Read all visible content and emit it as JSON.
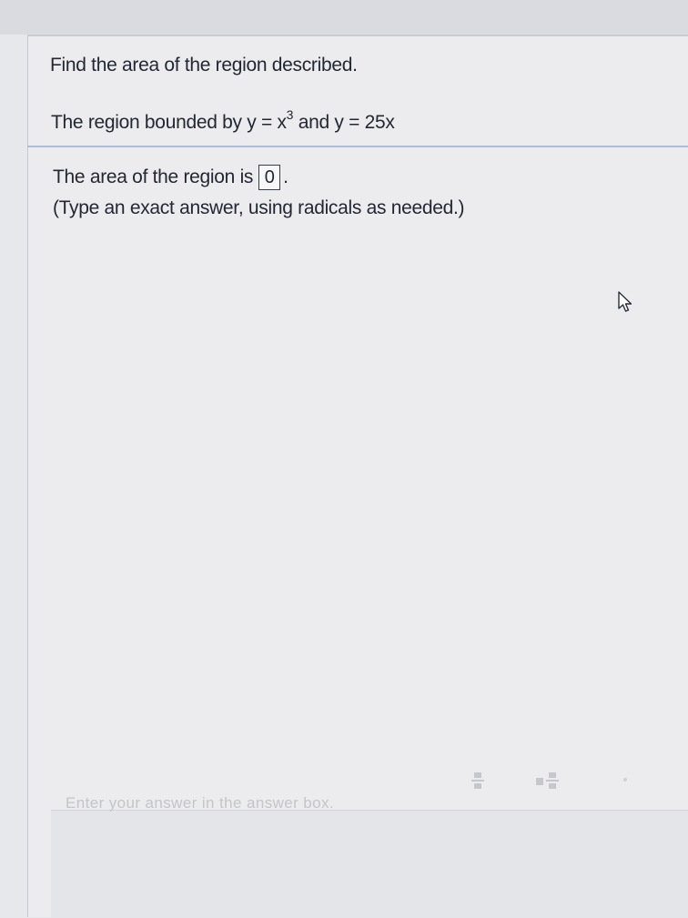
{
  "question": {
    "title": "Find the area of the region described.",
    "region_prefix": "The region bounded by y = x",
    "region_exponent": "3",
    "region_suffix": " and y = 25x"
  },
  "answer": {
    "prompt": "The area of the region is",
    "value": "0",
    "period": ".",
    "hint": "(Type an exact answer, using radicals as needed.)"
  },
  "footer": {
    "status": "Enter your answer in the answer box."
  },
  "icons": {
    "cursor": "mouse-pointer-icon",
    "toolbar": [
      "fraction-icon",
      "mixed-number-icon",
      "more-icon"
    ]
  },
  "colors": {
    "background": "#e7e8eb",
    "divider": "#aebbd2",
    "text": "#232733",
    "status_text": "#c3c5c9"
  }
}
